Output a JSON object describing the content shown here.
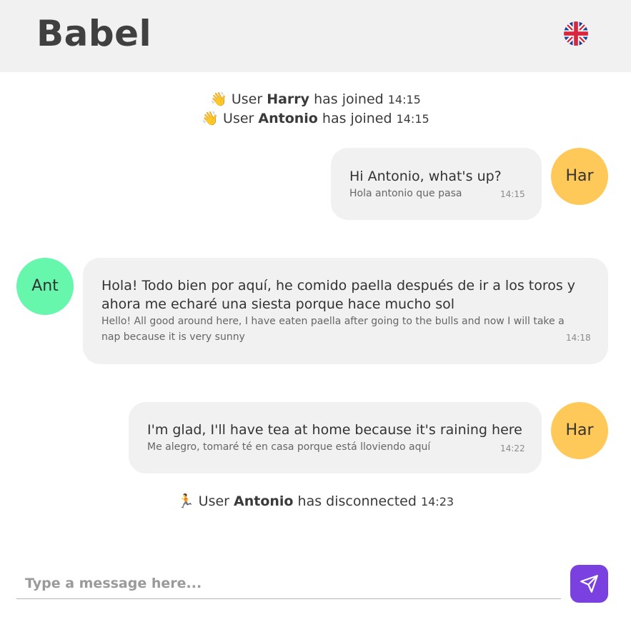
{
  "app": {
    "title": "Babel",
    "language_icon": "uk-flag-icon"
  },
  "system_messages": [
    {
      "emoji": "👋",
      "prefix": "User ",
      "user": "Harry",
      "suffix": " has joined ",
      "time": "14:15"
    },
    {
      "emoji": "👋",
      "prefix": "User ",
      "user": "Antonio",
      "suffix": " has joined ",
      "time": "14:15"
    },
    {
      "emoji": "🏃",
      "prefix": "User ",
      "user": "Antonio",
      "suffix": " has disconnected ",
      "time": "14:23"
    }
  ],
  "messages": [
    {
      "sender_initials": "Har",
      "text": "Hi Antonio, what's up?",
      "translation": "Hola antonio que pasa",
      "time": "14:15",
      "color": "#ffc95a"
    },
    {
      "sender_initials": "Ant",
      "text_line1": "Hola! Todo bien por aquí, he comido paella después de ir a los toros y",
      "text_line2": "ahora me echaré una siesta porque hace mucho sol",
      "translation_line1": "Hello! All good around here, I have eaten paella after going to the bulls and now I will take a",
      "translation_line2": "nap because it is very sunny",
      "time": "14:18",
      "color": "#66f7ad"
    },
    {
      "sender_initials": "Har",
      "text": "I'm glad, I'll have tea at home because it's raining here",
      "translation": "Me alegro, tomaré té en casa porque está lloviendo aquí",
      "time": "14:22",
      "color": "#ffc95a"
    }
  ],
  "composer": {
    "placeholder": "Type a message here...",
    "value": "",
    "send_icon": "send-icon",
    "send_color": "#7b40e0"
  }
}
